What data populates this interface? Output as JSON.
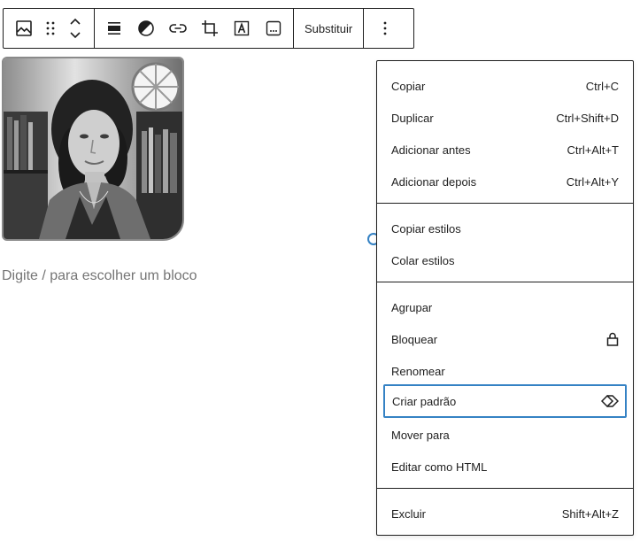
{
  "toolbar": {
    "block_type_icon": "image-icon",
    "drag_icon": "drag-handle-icon",
    "move_up_icon": "chevron-up-icon",
    "move_down_icon": "chevron-down-icon",
    "align_icon": "align-icon",
    "duotone_icon": "duotone-filter-icon",
    "link_icon": "link-icon",
    "crop_icon": "crop-icon",
    "text_overlay_icon": "text-overlay-icon",
    "caption_icon": "caption-icon",
    "replace_label": "Substituir",
    "more_icon": "more-vertical-icon"
  },
  "editor": {
    "image_alt": "Retrato em preto e branco de uma mulher",
    "placeholder": "Digite / para escolher um bloco"
  },
  "menu": {
    "section1": [
      {
        "label": "Copiar",
        "shortcut": "Ctrl+C"
      },
      {
        "label": "Duplicar",
        "shortcut": "Ctrl+Shift+D"
      },
      {
        "label": "Adicionar antes",
        "shortcut": "Ctrl+Alt+T"
      },
      {
        "label": "Adicionar depois",
        "shortcut": "Ctrl+Alt+Y"
      }
    ],
    "section2": [
      {
        "label": "Copiar estilos"
      },
      {
        "label": "Colar estilos"
      }
    ],
    "section3": [
      {
        "label": "Agrupar"
      },
      {
        "label": "Bloquear",
        "icon": "lock-icon"
      },
      {
        "label": "Renomear"
      },
      {
        "label": "Criar padrão",
        "icon": "pattern-icon",
        "focused": true
      },
      {
        "label": "Mover para"
      },
      {
        "label": "Editar como HTML"
      }
    ],
    "section4": [
      {
        "label": "Excluir",
        "shortcut": "Shift+Alt+Z"
      }
    ]
  },
  "colors": {
    "focus_ring": "#3582c4",
    "text": "#1e1e1e",
    "placeholder": "#757575"
  }
}
